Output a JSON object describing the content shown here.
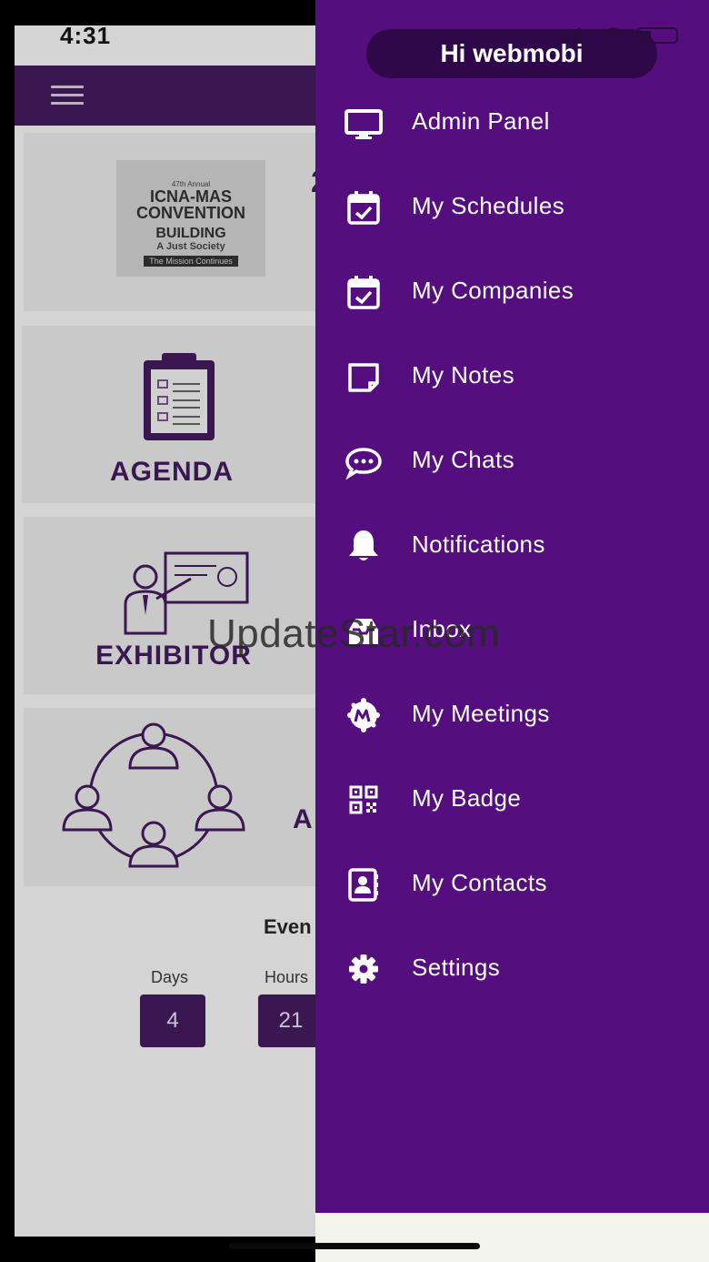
{
  "status_bar": {
    "time": "4:31"
  },
  "background_app": {
    "banner": {
      "line1": "47th Annual",
      "line2": "ICNA-MAS",
      "line3": "CONVENTION",
      "line4": "BUILDING",
      "line5": "A Just Society",
      "line6": "The Mission Continues",
      "partial_number": "2"
    },
    "tiles": [
      {
        "label": "AGENDA",
        "icon": "clipboard-checklist-icon"
      },
      {
        "label": "EXHIBITOR",
        "icon": "presenter-board-icon"
      },
      {
        "label": "A",
        "icon": "network-people-icon"
      }
    ],
    "countdown": {
      "title": "Even",
      "units": [
        {
          "label": "Days",
          "value": "4"
        },
        {
          "label": "Hours",
          "value": "21"
        }
      ]
    }
  },
  "drawer": {
    "greeting": "Hi webmobi",
    "items": [
      {
        "label": "Admin Panel",
        "icon": "monitor-icon"
      },
      {
        "label": "My Schedules",
        "icon": "calendar-check-icon"
      },
      {
        "label": "My Companies",
        "icon": "calendar-check-icon"
      },
      {
        "label": "My Notes",
        "icon": "sticky-note-icon"
      },
      {
        "label": "My Chats",
        "icon": "chat-bubble-icon"
      },
      {
        "label": "Notifications",
        "icon": "bell-icon"
      },
      {
        "label": "Inbox",
        "icon": "inbox-icon"
      },
      {
        "label": "My Meetings",
        "icon": "meetup-icon"
      },
      {
        "label": "My Badge",
        "icon": "qr-code-icon"
      },
      {
        "label": "My Contacts",
        "icon": "contact-card-icon"
      },
      {
        "label": "Settings",
        "icon": "gear-icon"
      }
    ]
  },
  "watermark": "UpdateStar.com",
  "colors": {
    "drawer": "#540e7e",
    "pill": "#2f0849",
    "brand": "#3b1752"
  }
}
